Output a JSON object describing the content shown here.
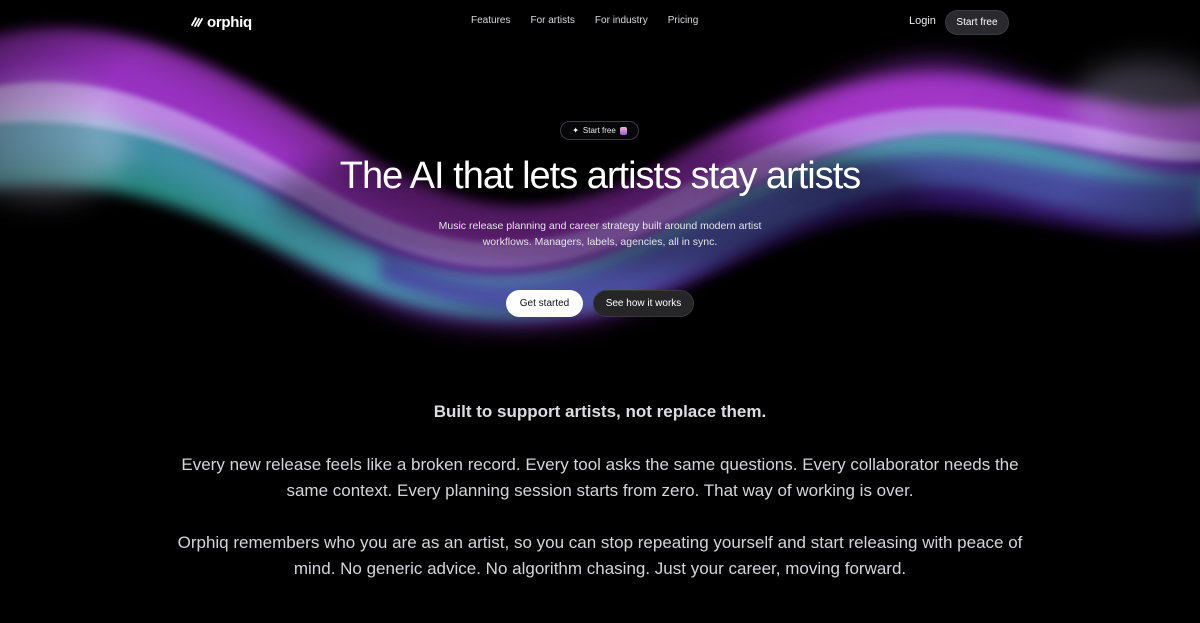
{
  "brand": {
    "name": "orphiq",
    "logo_icon": "orphiq-logo-icon"
  },
  "nav": {
    "links": [
      {
        "label": "Features"
      },
      {
        "label": "For artists"
      },
      {
        "label": "For industry"
      },
      {
        "label": "Pricing"
      }
    ],
    "login_label": "Login",
    "start_free_label": "Start free"
  },
  "hero": {
    "badge_label": "Start free",
    "badge_icons": [
      "sparkle-icon",
      "emoji-icon"
    ],
    "title": "The AI that lets artists stay artists",
    "subtitle": "Music release planning and career strategy built around modern artist workflows. Managers, labels, agencies, all in sync.",
    "primary_cta": "Get started",
    "secondary_cta": "See how it works"
  },
  "intro": {
    "heading": "Built to support artists, not replace them.",
    "paragraph_1": "Every new release feels like a broken record. Every tool asks the same questions. Every collaborator needs the same context. Every planning session starts from zero. That way of working is over.",
    "paragraph_2": "Orphiq remembers who you are as an artist, so you can stop repeating yourself and start releasing with peace of mind. No generic advice. No algorithm chasing. Just your career, moving forward."
  },
  "colors": {
    "background": "#000000",
    "wave_purple": "#7a2fd0",
    "wave_magenta": "#c13bd6",
    "wave_teal": "#3fd2b8",
    "wave_lilac": "#c9b3f2"
  }
}
